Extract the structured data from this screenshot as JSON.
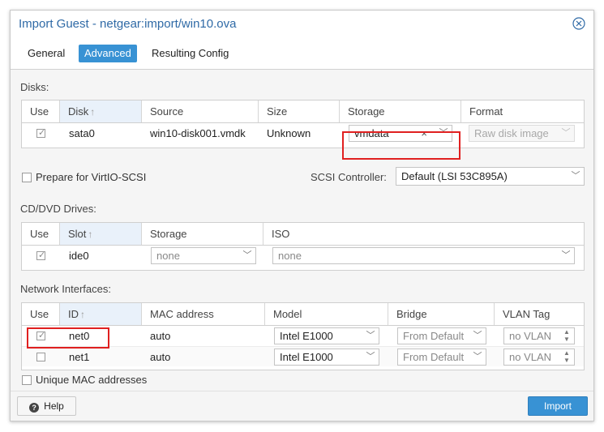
{
  "dialog": {
    "title": "Import Guest - netgear:import/win10.ova",
    "close_icon": "close-icon"
  },
  "tabs": [
    {
      "label": "General",
      "active": false
    },
    {
      "label": "Advanced",
      "active": true
    },
    {
      "label": "Resulting Config",
      "active": false
    }
  ],
  "disks": {
    "section_label": "Disks:",
    "columns": [
      "Use",
      "Disk",
      "Source",
      "Size",
      "Storage",
      "Format"
    ],
    "sort_arrow": "↑",
    "rows": [
      {
        "use": true,
        "disk": "sata0",
        "source": "win10-disk001.vmdk",
        "size": "Unknown",
        "storage": "vmdata",
        "format": "Raw disk image"
      }
    ]
  },
  "virtio": {
    "checkbox_label": "Prepare for VirtIO-SCSI",
    "checked": false,
    "scsi_label": "SCSI Controller:",
    "scsi_value": "Default (LSI 53C895A)"
  },
  "cdrom": {
    "section_label": "CD/DVD Drives:",
    "columns": [
      "Use",
      "Slot",
      "Storage",
      "ISO"
    ],
    "sort_arrow": "↑",
    "rows": [
      {
        "use": true,
        "slot": "ide0",
        "storage": "none",
        "iso": "none"
      }
    ]
  },
  "network": {
    "section_label": "Network Interfaces:",
    "columns": [
      "Use",
      "ID",
      "MAC address",
      "Model",
      "Bridge",
      "VLAN Tag"
    ],
    "sort_arrow": "↑",
    "rows": [
      {
        "use": true,
        "id": "net0",
        "mac": "auto",
        "model": "Intel E1000",
        "bridge": "From Default",
        "vlan": "no VLAN"
      },
      {
        "use": false,
        "id": "net1",
        "mac": "auto",
        "model": "Intel E1000",
        "bridge": "From Default",
        "vlan": "no VLAN"
      }
    ]
  },
  "unique_mac": {
    "checkbox_label": "Unique MAC addresses",
    "checked": false
  },
  "footer": {
    "help_label": "Help",
    "help_icon_glyph": "?",
    "import_label": "Import"
  },
  "colors": {
    "accent": "#3892d4",
    "highlight_box": "#e02020",
    "title": "#2f6aa6"
  }
}
